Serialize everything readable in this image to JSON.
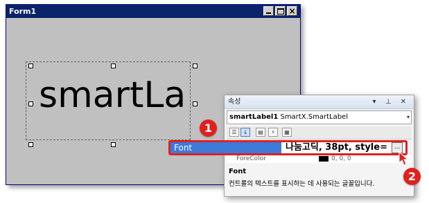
{
  "form": {
    "title": "Form1",
    "close_glyph": "×"
  },
  "label": {
    "text": "smartLa"
  },
  "properties": {
    "title": "속성",
    "title_icons": "▾ ⊥ ✕",
    "object_name": "smartLabel1",
    "object_type": "SmartX.SmartLabel",
    "partial_row": {
      "name": "ForeColor",
      "value": "0, 0, 0",
      "swatch_color": "#000000"
    },
    "description_title": "Font",
    "description_text": "컨트롤의 텍스트를 표시하는 데 사용되는 글꼴입니다."
  },
  "font_row": {
    "name": "Font",
    "value": "나눔고딕, 38pt, style=",
    "button_label": "..."
  },
  "markers": [
    "1",
    "2"
  ],
  "colors": {
    "form_title_bar": "#0a246a",
    "form_client": "#c0c0c0",
    "selected_row": "#3d7ad8",
    "highlight_border": "#e02020",
    "marker": "#e02020"
  }
}
